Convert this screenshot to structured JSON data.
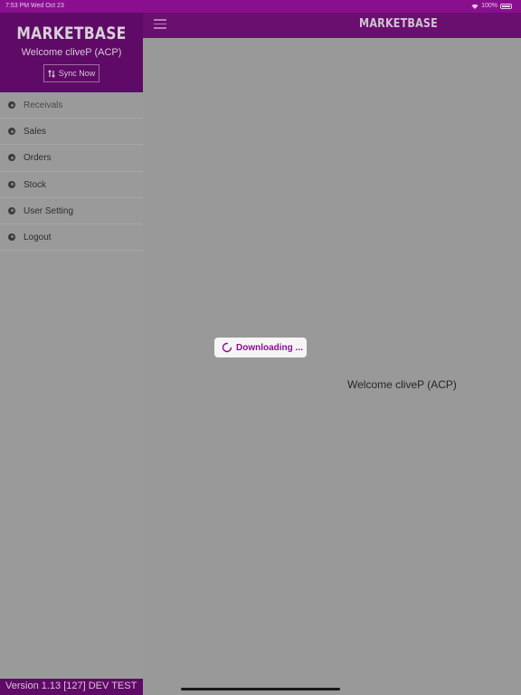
{
  "status_bar": {
    "time": "7:53 PM  Wed Oct 23",
    "battery": "100%"
  },
  "app_bar": {
    "title": "MARKETBASE"
  },
  "drawer": {
    "brand": "MARKETBASE",
    "welcome": "Welcome cliveP (ACP)",
    "sync_label": "Sync Now",
    "items": [
      {
        "label": "Receivals",
        "icon": "receivals-icon"
      },
      {
        "label": "Sales",
        "icon": "sales-icon"
      },
      {
        "label": "Orders",
        "icon": "orders-icon"
      },
      {
        "label": "Stock",
        "icon": "stock-icon"
      },
      {
        "label": "User Setting",
        "icon": "user-setting-icon"
      },
      {
        "label": "Logout",
        "icon": "logout-icon"
      }
    ]
  },
  "main": {
    "welcome": "Welcome cliveP (ACP)"
  },
  "loading": {
    "text": "Downloading ..."
  },
  "footer": {
    "version": "Version 1.13 [127] DEV TEST"
  },
  "colors": {
    "primary": "#6a0e6f",
    "status_bar": "#8a0f8f",
    "overlay": "#999999",
    "accent_text": "#8a1090"
  }
}
